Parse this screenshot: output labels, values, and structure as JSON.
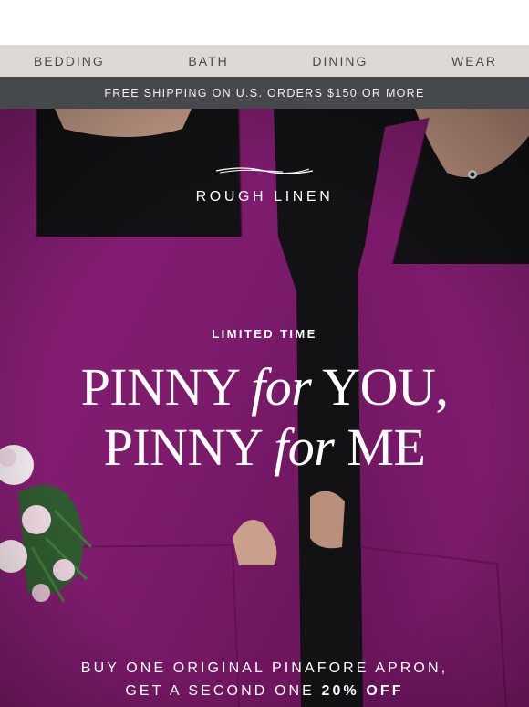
{
  "nav": {
    "items": [
      {
        "label": "BEDDING"
      },
      {
        "label": "BATH"
      },
      {
        "label": "DINING"
      },
      {
        "label": "WEAR"
      }
    ]
  },
  "promo_bar": {
    "text": "FREE SHIPPING ON U.S. ORDERS $150 OR MORE"
  },
  "hero": {
    "brand": "ROUGH LINEN",
    "eyebrow": "LIMITED TIME",
    "headline": {
      "line1_a": "PINNY ",
      "line1_em": "for",
      "line1_b": " YOU,",
      "line2_a": "PINNY ",
      "line2_em": "for",
      "line2_b": " ME"
    },
    "offer": {
      "line1": "BUY ONE ORIGINAL PINAFORE APRON,",
      "line2_a": "GET A SECOND ONE ",
      "line2_strong": "20% OFF"
    }
  },
  "colors": {
    "nav_bg": "#dcd8d3",
    "promo_bg": "#46494c",
    "apron": "#7f1c6e",
    "shirt": "#141316"
  }
}
